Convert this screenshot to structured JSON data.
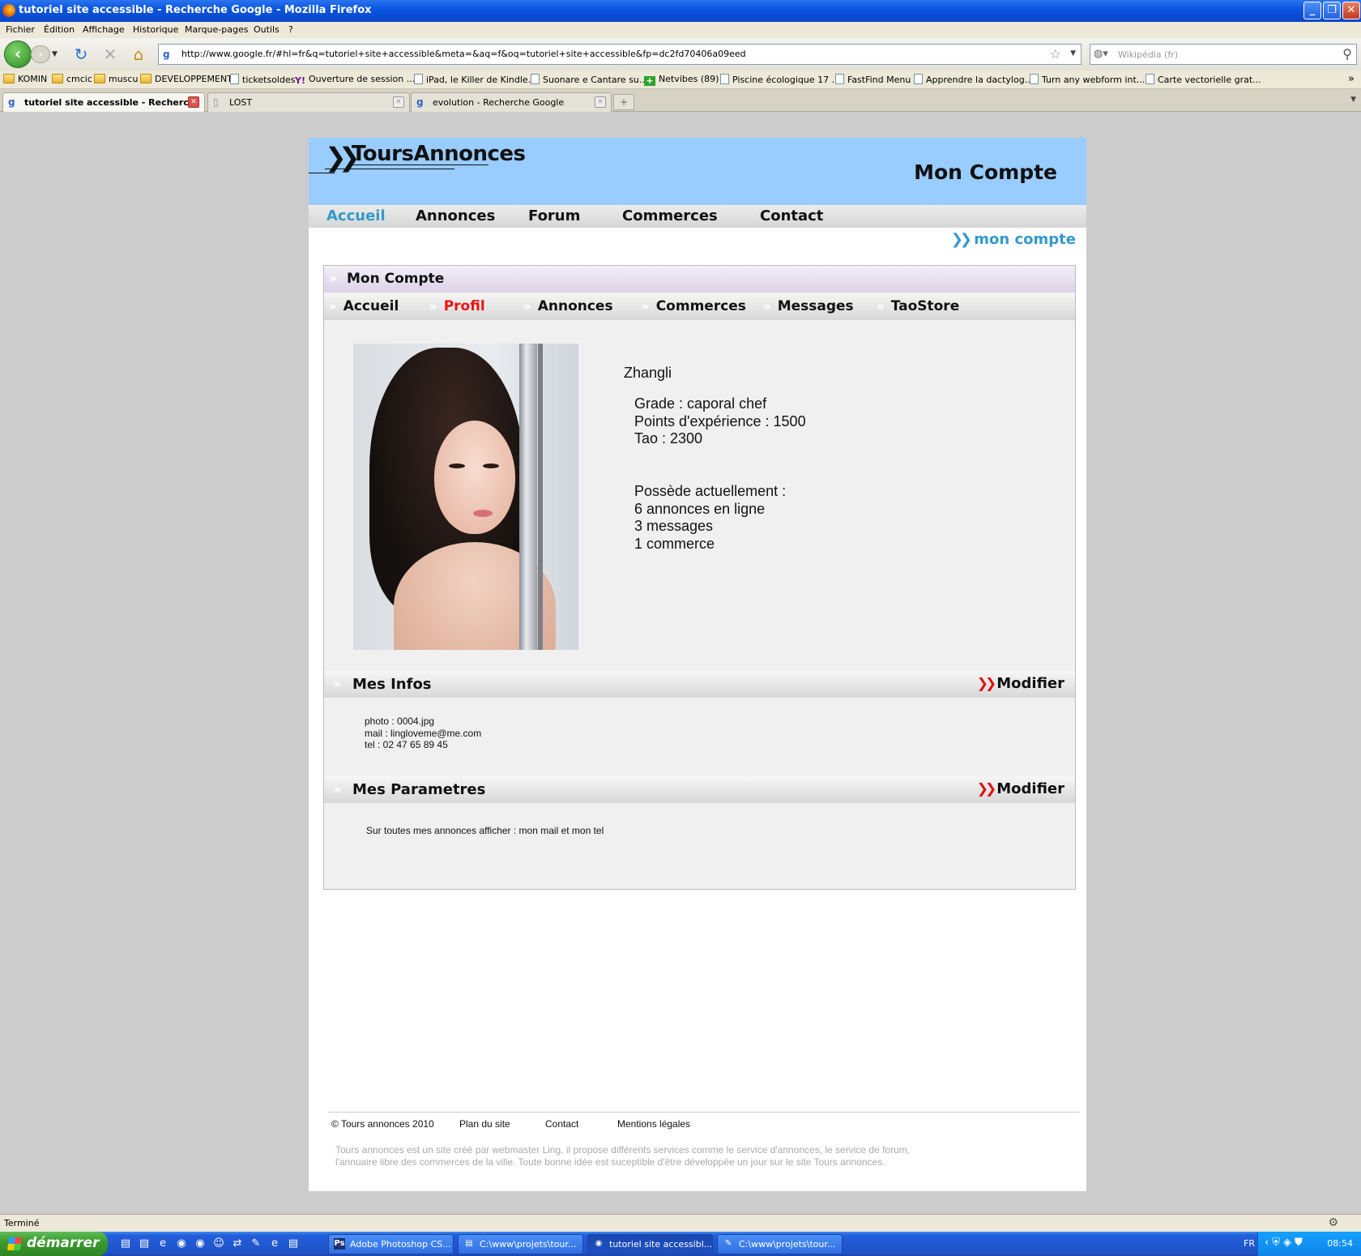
{
  "window": {
    "title": "tutoriel site accessible - Recherche Google - Mozilla Firefox",
    "controls": {
      "minimize": "_",
      "restore": "❐",
      "close": "✕"
    }
  },
  "menubar": [
    "Fichier",
    "Édition",
    "Affichage",
    "Historique",
    "Marque-pages",
    "Outils",
    "?"
  ],
  "navbar": {
    "url": "http://www.google.fr/#hl=fr&q=tutoriel+site+accessible&meta=&aq=f&oq=tutoriel+site+accessible&fp=dc2fd70406a09eed",
    "search_placeholder": "Wikipédia (fr)"
  },
  "bookmarks": [
    {
      "label": "KOMIN",
      "icon": "folder"
    },
    {
      "label": "cmcic",
      "icon": "folder"
    },
    {
      "label": "muscu",
      "icon": "folder"
    },
    {
      "label": "DEVELOPPEMENT",
      "icon": "folder"
    },
    {
      "label": "ticketsoldes",
      "icon": "page"
    },
    {
      "label": "Ouverture de session ...",
      "icon": "yahoo"
    },
    {
      "label": "iPad, le Killer de Kindle...",
      "icon": "page"
    },
    {
      "label": "Suonare e Cantare su...",
      "icon": "page"
    },
    {
      "label": "Netvibes (89)",
      "icon": "plus"
    },
    {
      "label": "Piscine écologique 17 ...",
      "icon": "page"
    },
    {
      "label": "FastFind Menu",
      "icon": "page"
    },
    {
      "label": "Apprendre la dactylog...",
      "icon": "page"
    },
    {
      "label": "Turn any webform int...",
      "icon": "page"
    },
    {
      "label": "Carte vectorielle grat...",
      "icon": "page"
    }
  ],
  "tabs": [
    {
      "label": "tutoriel site accessible - Recherc...",
      "icon": "google-icon"
    },
    {
      "label": "LOST",
      "icon": "page-icon"
    },
    {
      "label": "evolution - Recherche Google",
      "icon": "google-icon"
    }
  ],
  "site": {
    "logo": "ToursAnnonces",
    "header_title": "Mon Compte",
    "nav": [
      "Accueil",
      "Annonces",
      "Forum",
      "Commerces",
      "Contact"
    ],
    "nav_current": "Accueil",
    "breadcrumb": "mon compte",
    "panel_title": "Mon Compte",
    "subnav": [
      "Accueil",
      "Profil",
      "Annonces",
      "Commerces",
      "Messages",
      "TaoStore"
    ],
    "subnav_current": "Profil",
    "profile": {
      "name": "Zhangli",
      "stats": [
        "Grade : caporal chef",
        "Points d'expérience : 1500",
        "Tao : 2300"
      ],
      "own": [
        "Possède actuellement :",
        "6 annonces en ligne",
        "3 messages",
        "1 commerce"
      ]
    },
    "infos": {
      "title": "Mes Infos",
      "modify": "Modifier",
      "lines": [
        "photo : 0004.jpg",
        "mail : lingloveme@me.com",
        "tel : 02 47 65 89 45"
      ]
    },
    "params": {
      "title": "Mes Parametres",
      "modify": "Modifier",
      "text": "Sur toutes mes annonces afficher : mon mail et mon tel"
    },
    "footer": {
      "links": [
        "© Tours annonces 2010",
        "Plan du site",
        "Contact",
        "Mentions légales"
      ],
      "text": "Tours annonces est un site créé par webmaster Ling, il propose différents services comme le service d'annonces, le service de forum, l'annuaire libre des commerces de la ville. Toute bonne idée est suceptible d'être développée un jour sur le site Tours annonces."
    },
    "colors": {
      "header_bg": "#99ccff",
      "accent_blue": "#3399cc",
      "accent_red": "#ee1111"
    }
  },
  "statusbar": {
    "text": "Terminé"
  },
  "taskbar": {
    "start": "démarrer",
    "tasks": [
      {
        "label": "Adobe Photoshop CS...",
        "icon": "Ps"
      },
      {
        "label": "C:\\www\\projets\\tour...",
        "icon": "folder"
      },
      {
        "label": "tutoriel site accessibl...",
        "icon": "firefox"
      },
      {
        "label": "C:\\www\\projets\\tour...",
        "icon": "notepad"
      }
    ],
    "lang": "FR",
    "clock": "08:54"
  }
}
